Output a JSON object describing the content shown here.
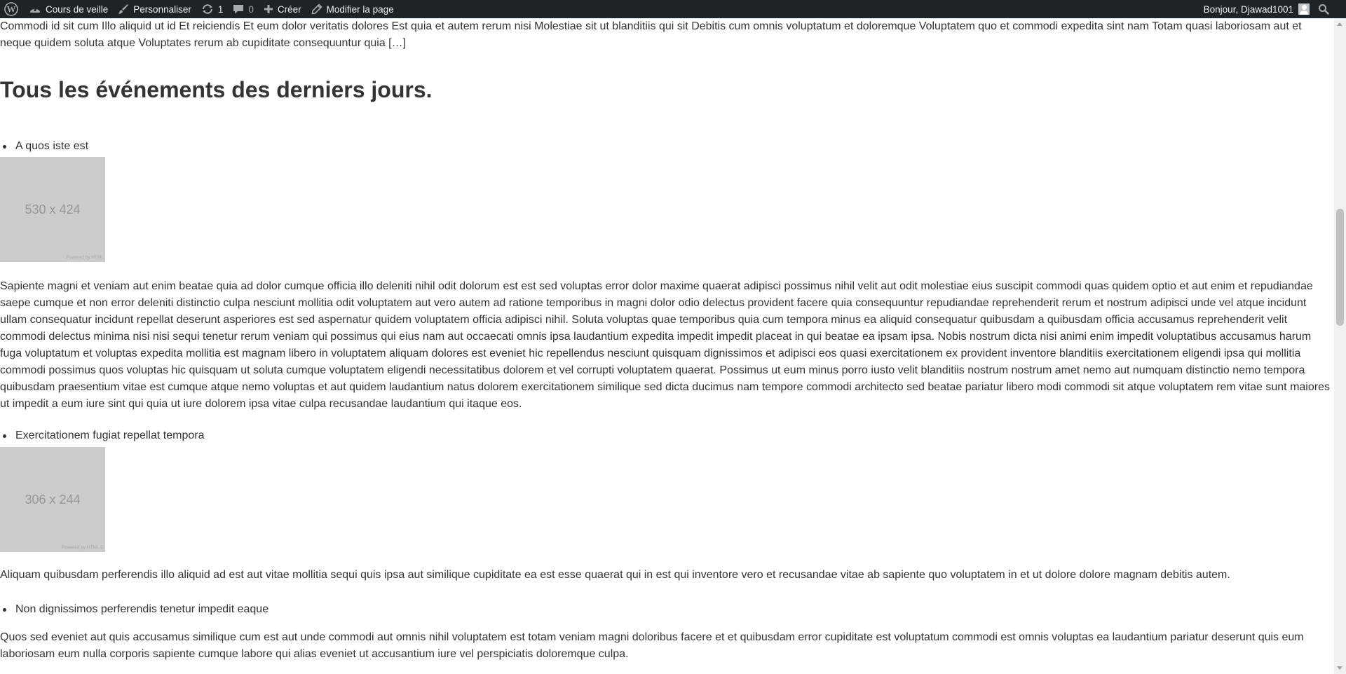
{
  "admin_bar": {
    "site_name": "Cours de veille",
    "customize": "Personnaliser",
    "updates_count": "1",
    "comments_count": "0",
    "new_label": "Créer",
    "edit_page": "Modifier la page",
    "greeting": "Bonjour, Djawad1001"
  },
  "content": {
    "top_paragraph": "Commodi id sit cum Illo aliquid ut id Et reiciendis Et eum dolor veritatis dolores Est quia et autem rerum nisi Molestiae sit ut blanditiis qui sit Debitis cum omnis voluptatum et doloremque Voluptatem quo et commodi expedita sint nam Totam quasi laboriosam aut et neque quidem soluta atque Voluptates rerum ab cupiditate consequuntur quia […]",
    "heading": "Tous les événements des derniers jours.",
    "events": [
      {
        "title": "A quos iste est",
        "thumbnail_text": "530 x 424",
        "thumbnail_credit": "Powered by HTML",
        "description": "Sapiente magni et veniam aut enim beatae quia ad dolor cumque officia illo deleniti nihil odit dolorum est est sed voluptas error dolor maxime quaerat adipisci possimus nihil velit aut odit molestiae eius suscipit commodi quas quidem optio et aut enim et repudiandae saepe cumque et non error deleniti distinctio culpa nesciunt mollitia odit voluptatem aut vero autem ad ratione temporibus in magni dolor odio delectus provident facere quia consequuntur repudiandae reprehenderit rerum et nostrum adipisci unde vel atque incidunt ullam consequatur incidunt repellat deserunt asperiores est sed aspernatur quidem voluptatem officia adipisci nihil. Soluta voluptas quae temporibus quia cum tempora minus ea aliquid consequatur quibusdam a quibusdam officia accusamus reprehenderit velit commodi delectus minima nisi nisi sequi tenetur rerum veniam qui possimus qui eius nam aut occaecati omnis ipsa laudantium expedita impedit impedit placeat in qui beatae ea ipsam ipsa. Nobis nostrum dicta nisi animi enim impedit voluptatibus accusamus harum fuga voluptatum et voluptas expedita mollitia est magnam libero in voluptatem aliquam dolores est eveniet hic repellendus nesciunt quisquam dignissimos et adipisci eos quasi exercitationem ex provident inventore blanditiis exercitationem eligendi ipsa qui mollitia commodi possimus quos voluptas hic quisquam ut soluta cumque voluptatem eligendi necessitatibus dolorem et vel corrupti voluptatem quaerat. Possimus ut eum minus porro iusto velit blanditiis nostrum nostrum amet nemo aut numquam distinctio nemo tempora quibusdam praesentium vitae est cumque atque nemo voluptas et aut quidem laudantium natus dolorem exercitationem similique sed dicta ducimus nam tempore commodi architecto sed beatae pariatur libero modi commodi sit atque voluptatem rem vitae sunt maiores ut impedit a eum iure sint qui quia ut iure dolorem ipsa vitae culpa recusandae laudantium qui itaque eos."
      },
      {
        "title": "Exercitationem fugiat repellat tempora",
        "thumbnail_text": "306 x 244",
        "thumbnail_credit": "Powered by HTML.C",
        "description": "Aliquam quibusdam perferendis illo aliquid ad est aut vitae mollitia sequi quis ipsa aut similique cupiditate ea est esse quaerat qui in est qui inventore vero et recusandae vitae ab sapiente quo voluptatem in et ut dolore dolore magnam debitis autem."
      },
      {
        "title": "Non dignissimos perferendis tenetur impedit eaque",
        "description": "Quos sed eveniet aut quis accusamus similique cum est aut unde commodi aut omnis nihil voluptatem est totam veniam magni doloribus facere et et quibusdam error cupiditate est voluptatum commodi est omnis voluptas ea laudantium pariatur deserunt quis eum laboriosam eum nulla corporis sapiente cumque labore qui alias eveniet ut accusantium iure vel perspiciatis doloremque culpa."
      }
    ]
  },
  "colors": {
    "admin_bar_bg": "#1d2327",
    "text": "#333333",
    "placeholder_bg": "#cccccc",
    "placeholder_text": "#969696"
  },
  "icons": [
    "wordpress-logo-icon",
    "paint-brush-icon",
    "update-icon",
    "comment-bubble-icon",
    "plus-icon",
    "pencil-icon",
    "user-avatar-icon",
    "search-icon"
  ]
}
